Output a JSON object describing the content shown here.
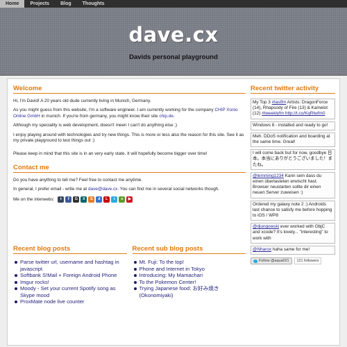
{
  "nav": {
    "items": [
      {
        "label": "Home"
      },
      {
        "label": "Projects"
      },
      {
        "label": "Blog"
      },
      {
        "label": "Thoughts"
      }
    ]
  },
  "header": {
    "title": "dave.cx",
    "subtitle": "Davids personal playground"
  },
  "welcome": {
    "heading": "Welcome",
    "p1": "Hi, I'm David! A 20 years old dude currently living in Munich, Germany.",
    "p2_a": "As you might guess from this website, I'm a software engineer. I am currently working for the company ",
    "p2_link": "CHIP Xonio Online GmbH",
    "p2_b": " in munich. If you're from germany, you might know their site ",
    "p2_link2": "chip.de",
    "p2_c": ".",
    "p3": "Although my speciality is web development, doesn't meen I can't do anything else ;)",
    "p4": "I enjoy playing around with technologies and try new things. This is more or less also the reason for this site. See it as my private playground to test things out :)",
    "p5": "Please keep in mind that this site is in an very early state. It will hopefully become bigger over time!"
  },
  "contact": {
    "heading": "Contact me",
    "p1": "Do you have anything to tell me? Feel free to contact me anytime.",
    "p2_a": "In general, I prefer email - write me at ",
    "email": "dave@dave.cx",
    "p2_b": ". You can find me in several social networks though.",
    "interwebs_label": "Me on the interwebs:",
    "social_icons": [
      {
        "name": "tumblr-icon",
        "glyph": "t",
        "color": "#35465c"
      },
      {
        "name": "facebook-icon",
        "glyph": "f",
        "color": "#3b5998"
      },
      {
        "name": "github-icon",
        "glyph": "G",
        "color": "#333333"
      },
      {
        "name": "xing-icon",
        "glyph": "X",
        "color": "#026466"
      },
      {
        "name": "stackoverflow-icon",
        "glyph": "S",
        "color": "#e87b22"
      },
      {
        "name": "delicious-icon",
        "glyph": "d",
        "color": "#3274d1"
      },
      {
        "name": "lastfm-icon",
        "glyph": "L",
        "color": "#c3000d"
      },
      {
        "name": "twitter-icon",
        "glyph": "t",
        "color": "#2aa9e0"
      },
      {
        "name": "xbox-icon",
        "glyph": "x",
        "color": "#5d9b2a"
      },
      {
        "name": "youtube-icon",
        "glyph": "▶",
        "color": "#cc181e"
      }
    ]
  },
  "blog": {
    "heading": "Recent blog posts",
    "posts": [
      "Parse twitter url, username and hashtag in javascript",
      "Softbank S!Mail + Foreign Android Phone",
      "Imgur rocks!",
      "Moody - Set your current Spotify song as Skype mood",
      "ProxMate node live counter"
    ]
  },
  "subblog": {
    "heading": "Recent sub blog posts",
    "posts": [
      "Mt. Fuji: To the top!",
      "Phone and Internet in Tokyo",
      "Introducing: My Mamachari",
      "To the Pokemon Center!",
      "Trying Japanese food: お好み焼き (Okonomiyaki)"
    ]
  },
  "twitter": {
    "heading": "Recent twitter activity",
    "tweets": [
      {
        "text": "My Top 3 ",
        "link": "#lastfm",
        "rest": " Artists: DragonForce (14), Rhapsody of Fire (13) & Kamelot (12) ",
        "link2": "#tweeklyfm",
        "link3": " http://t.co/KqRtwfm0"
      },
      {
        "text": "Windows 8 - installed and ready to go!",
        "link": "",
        "rest": "",
        "link2": "",
        "link3": ""
      },
      {
        "text": "Meh. DDoS notification and boarding at the same time. Great!",
        "link": "",
        "rest": "",
        "link2": "",
        "link3": ""
      },
      {
        "text": "I will come back but for now, goodbye 日本。本当にありがとうございました！またね。",
        "link": "",
        "rest": "",
        "link2": "",
        "link3": ""
      },
      {
        "text": "",
        "link": "@lemming1234",
        "rest": " Kann sein dass du einen überlasteten erwischt hast. Browser neustarten sollte dir einen neuen Server zuweisen :)",
        "link2": "",
        "link3": ""
      },
      {
        "text": "Ordered my galaxy note 2 :) Androids last chance to satisfy me before hopping to iOS / WP8",
        "link": "",
        "rest": "",
        "link2": "",
        "link3": ""
      },
      {
        "text": "",
        "link": "@djungowski",
        "rest": " ever worked with ObjC and xcode? It's lovely... \"interesting\" to work with",
        "link2": "",
        "link3": ""
      },
      {
        "text": "",
        "link": "@Nharox",
        "rest": " haha same for me!",
        "link2": "",
        "link3": ""
      }
    ],
    "follow_label": "Follow @aqua021",
    "followers": "121 followers"
  },
  "colors": {
    "accent": "#e07a10",
    "link": "#2a2a9a",
    "nav_bg": "#2f2f2f",
    "header_bg": "#7c8089"
  }
}
